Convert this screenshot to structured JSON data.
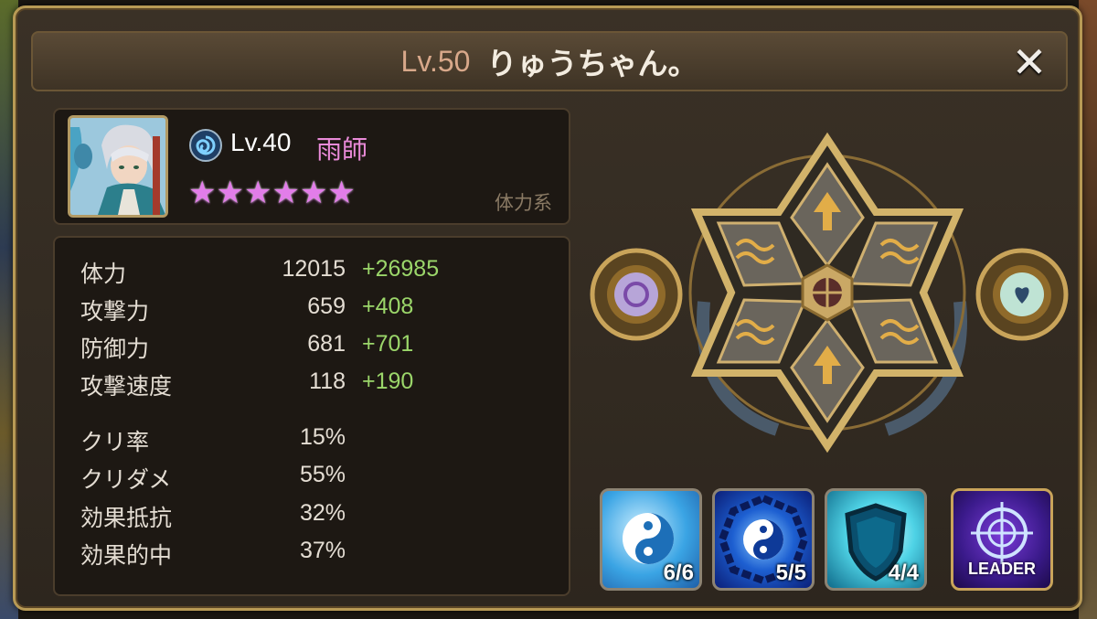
{
  "header": {
    "level": "Lv.50",
    "player_name": "りゅうちゃん。",
    "close_icon": "close-icon"
  },
  "monster": {
    "level": "Lv.40",
    "name": "雨師",
    "attribute": "water-swirl-icon",
    "stars": 6,
    "type": "体力系"
  },
  "stats": [
    {
      "label": "体力",
      "base": "12015",
      "bonus": "+26985"
    },
    {
      "label": "攻撃力",
      "base": "659",
      "bonus": "+408"
    },
    {
      "label": "防御力",
      "base": "681",
      "bonus": "+701"
    },
    {
      "label": "攻撃速度",
      "base": "118",
      "bonus": "+190"
    },
    {
      "label": "クリ率",
      "base": "15%",
      "bonus": ""
    },
    {
      "label": "クリダメ",
      "base": "55%",
      "bonus": ""
    },
    {
      "label": "効果抵抗",
      "base": "32%",
      "bonus": ""
    },
    {
      "label": "効果的中",
      "base": "37%",
      "bonus": ""
    }
  ],
  "skills": [
    {
      "icon": "yin-yang-icon",
      "level": "6/6"
    },
    {
      "icon": "bagua-yin-yang-icon",
      "level": "5/5"
    },
    {
      "icon": "shield-icon",
      "level": "4/4"
    },
    {
      "icon": "crosshair-icon",
      "label": "LEADER"
    }
  ],
  "colors": {
    "bonus": "#9bd66a",
    "monster_name": "#e98ad8",
    "stars": "#e27de9",
    "frame_gold": "#b89a55"
  }
}
